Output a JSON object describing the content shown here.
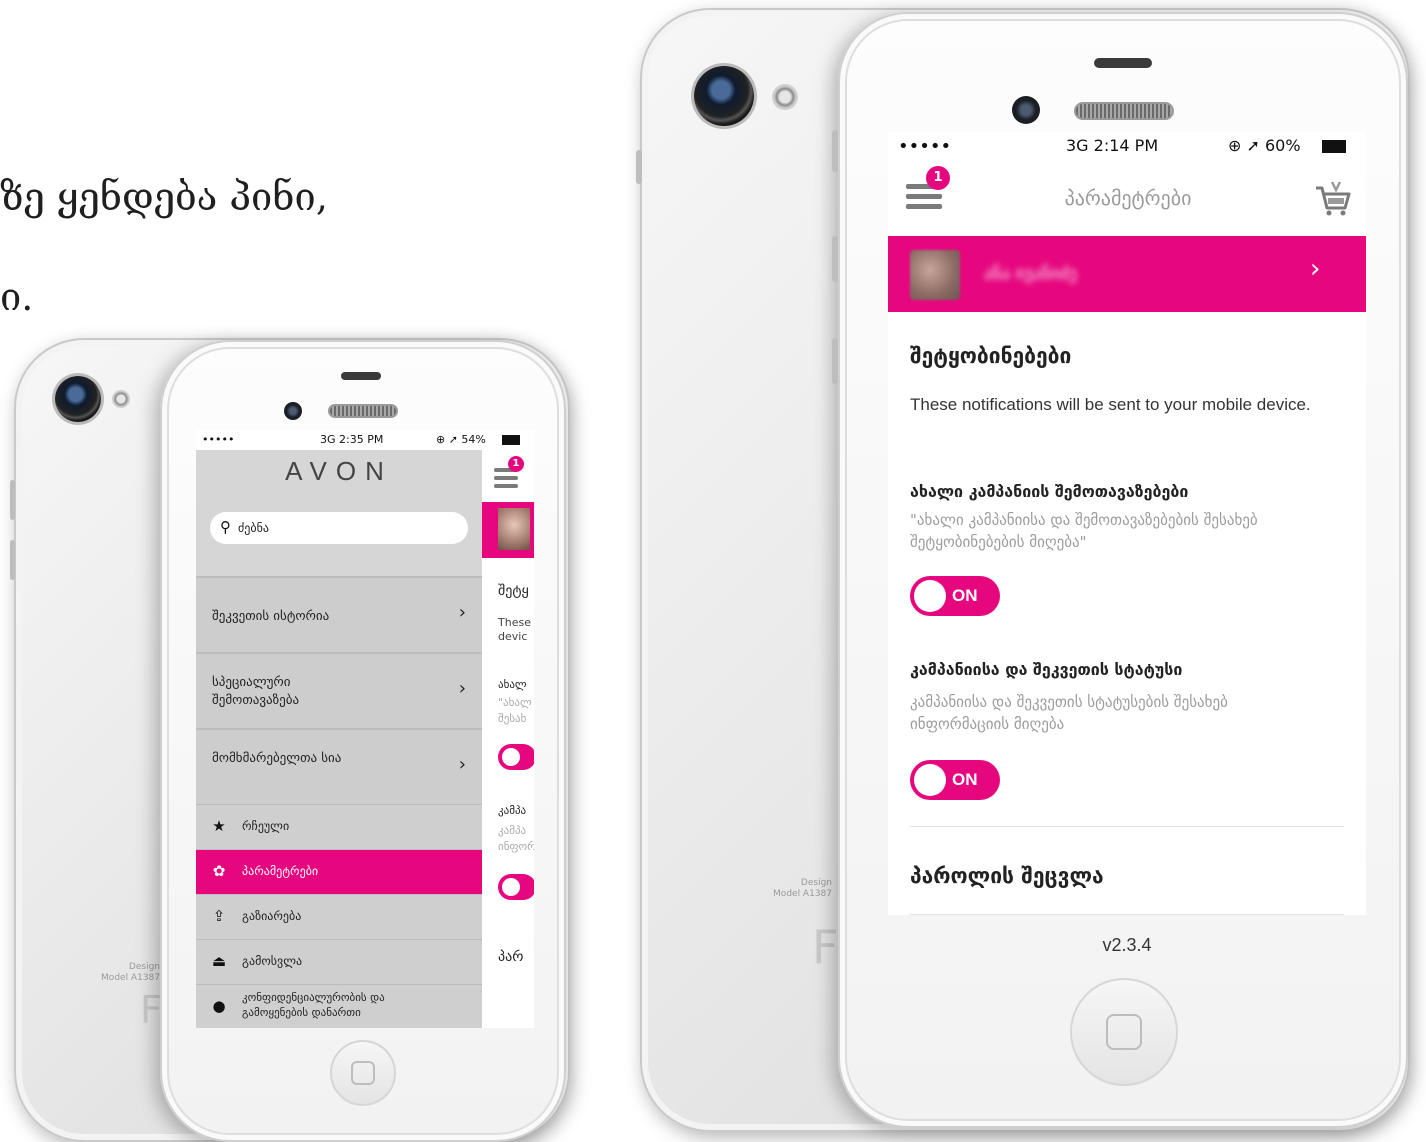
{
  "headline": {
    "line1": "ზე ყენდება პინი,",
    "line2": "ი."
  },
  "left_phone": {
    "status": {
      "signal": "•••••",
      "time": "3G 2:35 PM",
      "icons": "⊕ ➚ 54%"
    },
    "menu": {
      "brand": "AVON",
      "search_placeholder": "ძებნა",
      "items": [
        {
          "label": "შეკვეთის ისტორია",
          "chevron": "›"
        },
        {
          "label": "სპეციალური შემოთავაზება",
          "chevron": "›"
        },
        {
          "label": "მომხმარებელთა სია",
          "chevron": "›"
        }
      ],
      "rows": [
        {
          "icon": "★",
          "label": "რჩეული"
        },
        {
          "icon": "✿",
          "label": "პარამეტრები"
        },
        {
          "icon": "⇪",
          "label": "გაზიარება"
        },
        {
          "icon": "⏏",
          "label": "გამოსვლა"
        },
        {
          "icon": "●",
          "label": "კონფიდენციალურობის და გამოყენების დანართი"
        }
      ]
    },
    "peek": {
      "badge": "1",
      "texts": [
        "შეტყ",
        "These",
        "devic",
        "ახალ",
        "\"ახალ",
        "შესახ",
        "კამპა",
        "კამპა",
        "ინფორ",
        "პარ"
      ]
    },
    "back": {
      "design_text": "Design\nModel A1387",
      "logo": "F"
    }
  },
  "right_phone": {
    "status": {
      "signal": "•••••",
      "time": "3G 2:14 PM",
      "icons": "⊕ ➚ 60%"
    },
    "header": {
      "badge": "1",
      "title": "პარამეტრები"
    },
    "profile": {
      "name": "ანა ივანიძე",
      "chevron": "›"
    },
    "notifications": {
      "title": "შეტყობინებები",
      "description": "These notifications will be sent to your mobile device.",
      "options": [
        {
          "title": "ახალი კამპანიის შემოთავაზებები",
          "description": "\"ახალი კამპანიისა და შემოთავაზებების შესახებ შეტყობინებების მიღება\"",
          "toggle": "ON"
        },
        {
          "title": "კამპანიისა და შეკვეთის სტატუსი",
          "description": "კამპანიისა და შეკვეთის სტატუსების შესახებ ინფორმაციის მიღება",
          "toggle": "ON"
        }
      ]
    },
    "password": {
      "title": "პაროლის შეცვლა"
    },
    "footer": {
      "version": "v2.3.4"
    },
    "back": {
      "design_text": "Design\nModel A1387",
      "logo": "F"
    }
  },
  "colors": {
    "accent": "#e6077f",
    "menu_bg": "#d6d6d6",
    "text": "#222222",
    "muted": "#9c9c9c"
  }
}
